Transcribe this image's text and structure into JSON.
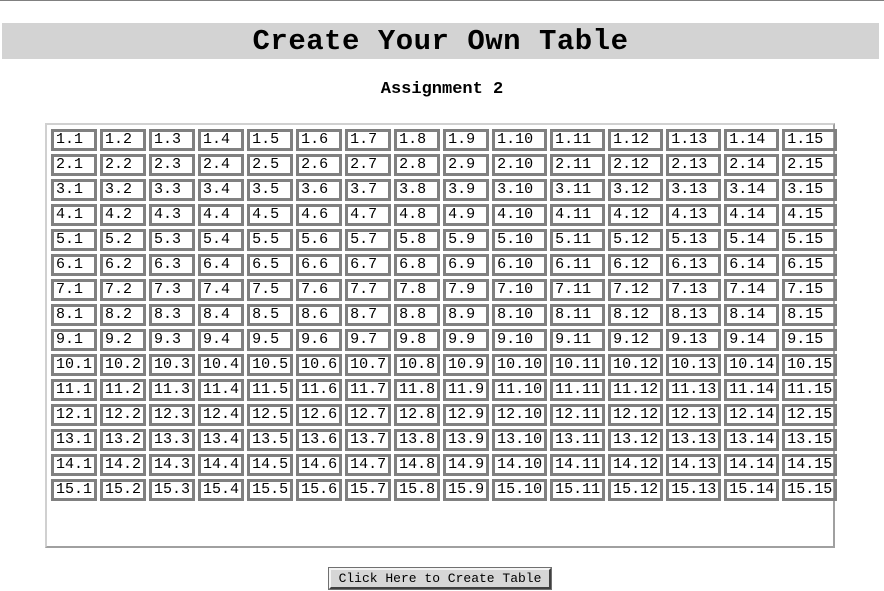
{
  "banner": {
    "title": "Create Your Own Table"
  },
  "subtitle": "Assignment 2",
  "table": {
    "rows": [
      [
        "1.1",
        "1.2",
        "1.3",
        "1.4",
        "1.5",
        "1.6",
        "1.7",
        "1.8",
        "1.9",
        "1.10",
        "1.11",
        "1.12",
        "1.13",
        "1.14",
        "1.15"
      ],
      [
        "2.1",
        "2.2",
        "2.3",
        "2.4",
        "2.5",
        "2.6",
        "2.7",
        "2.8",
        "2.9",
        "2.10",
        "2.11",
        "2.12",
        "2.13",
        "2.14",
        "2.15"
      ],
      [
        "3.1",
        "3.2",
        "3.3",
        "3.4",
        "3.5",
        "3.6",
        "3.7",
        "3.8",
        "3.9",
        "3.10",
        "3.11",
        "3.12",
        "3.13",
        "3.14",
        "3.15"
      ],
      [
        "4.1",
        "4.2",
        "4.3",
        "4.4",
        "4.5",
        "4.6",
        "4.7",
        "4.8",
        "4.9",
        "4.10",
        "4.11",
        "4.12",
        "4.13",
        "4.14",
        "4.15"
      ],
      [
        "5.1",
        "5.2",
        "5.3",
        "5.4",
        "5.5",
        "5.6",
        "5.7",
        "5.8",
        "5.9",
        "5.10",
        "5.11",
        "5.12",
        "5.13",
        "5.14",
        "5.15"
      ],
      [
        "6.1",
        "6.2",
        "6.3",
        "6.4",
        "6.5",
        "6.6",
        "6.7",
        "6.8",
        "6.9",
        "6.10",
        "6.11",
        "6.12",
        "6.13",
        "6.14",
        "6.15"
      ],
      [
        "7.1",
        "7.2",
        "7.3",
        "7.4",
        "7.5",
        "7.6",
        "7.7",
        "7.8",
        "7.9",
        "7.10",
        "7.11",
        "7.12",
        "7.13",
        "7.14",
        "7.15"
      ],
      [
        "8.1",
        "8.2",
        "8.3",
        "8.4",
        "8.5",
        "8.6",
        "8.7",
        "8.8",
        "8.9",
        "8.10",
        "8.11",
        "8.12",
        "8.13",
        "8.14",
        "8.15"
      ],
      [
        "9.1",
        "9.2",
        "9.3",
        "9.4",
        "9.5",
        "9.6",
        "9.7",
        "9.8",
        "9.9",
        "9.10",
        "9.11",
        "9.12",
        "9.13",
        "9.14",
        "9.15"
      ],
      [
        "10.1",
        "10.2",
        "10.3",
        "10.4",
        "10.5",
        "10.6",
        "10.7",
        "10.8",
        "10.9",
        "10.10",
        "10.11",
        "10.12",
        "10.13",
        "10.14",
        "10.15"
      ],
      [
        "11.1",
        "11.2",
        "11.3",
        "11.4",
        "11.5",
        "11.6",
        "11.7",
        "11.8",
        "11.9",
        "11.10",
        "11.11",
        "11.12",
        "11.13",
        "11.14",
        "11.15"
      ],
      [
        "12.1",
        "12.2",
        "12.3",
        "12.4",
        "12.5",
        "12.6",
        "12.7",
        "12.8",
        "12.9",
        "12.10",
        "12.11",
        "12.12",
        "12.13",
        "12.14",
        "12.15"
      ],
      [
        "13.1",
        "13.2",
        "13.3",
        "13.4",
        "13.5",
        "13.6",
        "13.7",
        "13.8",
        "13.9",
        "13.10",
        "13.11",
        "13.12",
        "13.13",
        "13.14",
        "13.15"
      ],
      [
        "14.1",
        "14.2",
        "14.3",
        "14.4",
        "14.5",
        "14.6",
        "14.7",
        "14.8",
        "14.9",
        "14.10",
        "14.11",
        "14.12",
        "14.13",
        "14.14",
        "14.15"
      ],
      [
        "15.1",
        "15.2",
        "15.3",
        "15.4",
        "15.5",
        "15.6",
        "15.7",
        "15.8",
        "15.9",
        "15.10",
        "15.11",
        "15.12",
        "15.13",
        "15.14",
        "15.15"
      ]
    ]
  },
  "button": {
    "label": "Click Here to Create Table"
  },
  "colors": {
    "banner_bg": "#d3d3d3",
    "cell_border": "#808080",
    "button_bg": "#d6d6d6"
  }
}
